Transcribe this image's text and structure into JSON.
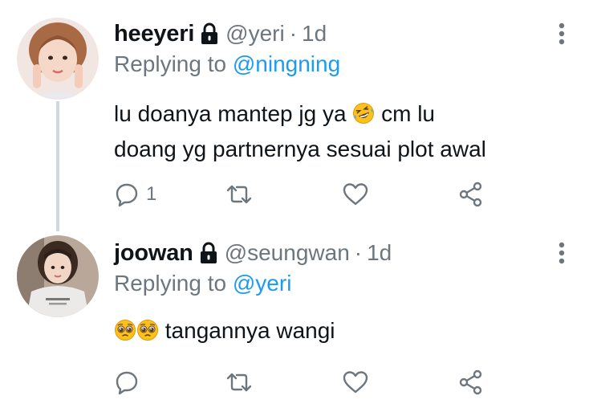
{
  "colors": {
    "text": "#0f1419",
    "secondary": "#6e767d",
    "accent": "#1d9bf0",
    "thread_line": "#cfd9de"
  },
  "tweets": [
    {
      "display_name": "heeyeri",
      "protected_icon": "lock-icon",
      "handle": "@yeri",
      "separator": "·",
      "time": "1d",
      "replying_prefix": "Replying to",
      "replying_to": "@ningning",
      "text_line_1": "lu doanya mantep jg ya",
      "text_emoji": "rolling-on-the-floor-laughing-emoji",
      "text_line_1_after": " cm lu",
      "text_line_2": "doang yg partnernya sesuai plot awal",
      "reply_count": "1",
      "actions": [
        "reply-icon",
        "retweet-icon",
        "like-icon",
        "share-icon"
      ]
    },
    {
      "display_name": "joowan",
      "protected_icon": "lock-icon",
      "handle": "@seungwan",
      "separator": "·",
      "time": "1d",
      "replying_prefix": "Replying to",
      "replying_to": "@yeri",
      "text_emojis": [
        "pleading-face-emoji",
        "pleading-face-emoji"
      ],
      "text_line_1": "tangannya wangi",
      "reply_count": "",
      "actions": [
        "reply-icon",
        "retweet-icon",
        "like-icon",
        "share-icon"
      ]
    }
  ]
}
